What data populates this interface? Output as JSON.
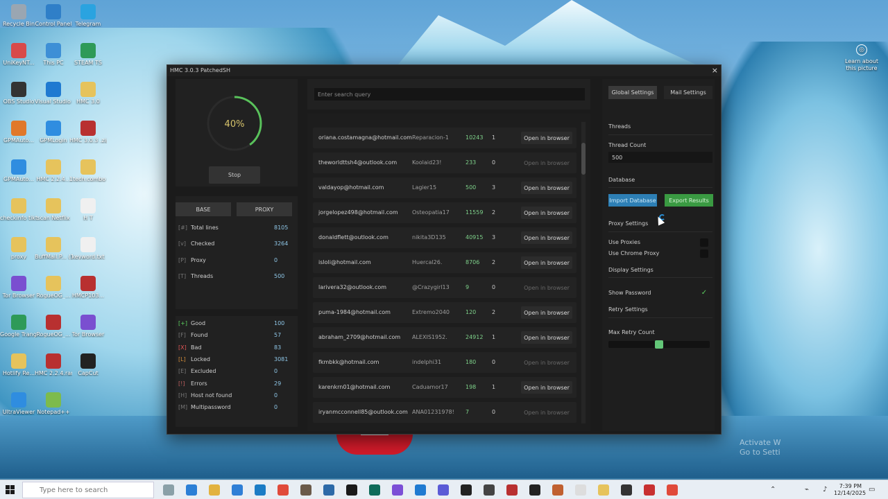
{
  "window": {
    "title": "HMC 3.0.3 PatchedSH",
    "close_label": "×"
  },
  "progress": {
    "percent_label": "40%",
    "percent_value": 40,
    "stop_label": "Stop"
  },
  "tabs": {
    "base_label": "BASE",
    "proxy_label": "PROXY"
  },
  "stats_top": [
    {
      "key": "[#]",
      "name": "Total lines",
      "value": "8105"
    },
    {
      "key": "[v]",
      "name": "Checked",
      "value": "3264"
    },
    {
      "key": "[P]",
      "name": "Proxy",
      "value": "0"
    },
    {
      "key": "[T]",
      "name": "Threads",
      "value": "500"
    }
  ],
  "stats_bottom": [
    {
      "key": "[+]",
      "name": "Good",
      "value": "100",
      "key_color": "#5bd15f"
    },
    {
      "key": "[F]",
      "name": "Found",
      "value": "57",
      "key_color": "#777777"
    },
    {
      "key": "[X]",
      "name": "Bad",
      "value": "83",
      "key_color": "#e05555"
    },
    {
      "key": "[L]",
      "name": "Locked",
      "value": "3081",
      "key_color": "#d08b3a"
    },
    {
      "key": "[E]",
      "name": "Excluded",
      "value": "0",
      "key_color": "#777777"
    },
    {
      "key": "[!]",
      "name": "Errors",
      "value": "29",
      "key_color": "#c06060"
    },
    {
      "key": "[H]",
      "name": "Host not found",
      "value": "0",
      "key_color": "#777777"
    },
    {
      "key": "[M]",
      "name": "Multipassword",
      "value": "0",
      "key_color": "#777777"
    }
  ],
  "search": {
    "placeholder": "Enter search query"
  },
  "results": [
    {
      "email": "oriana.costamagna@hotmail.com",
      "password": "Reparacion-1",
      "count": "10243",
      "mails": "1",
      "action": "Open in browser",
      "active": true
    },
    {
      "email": "theworldttsh4@outlook.com",
      "password": "Koolaid23!",
      "count": "233",
      "mails": "0",
      "action": "Open in browser",
      "active": false
    },
    {
      "email": "valdayop@hotmail.com",
      "password": "Lagier15",
      "count": "500",
      "mails": "3",
      "action": "Open in browser",
      "active": true
    },
    {
      "email": "jorgelopez498@hotmail.com",
      "password": "Osteopatia17",
      "count": "11559",
      "mails": "2",
      "action": "Open in browser",
      "active": true
    },
    {
      "email": "donaldflett@outlook.com",
      "password": "nikita3D135",
      "count": "40915",
      "mails": "3",
      "action": "Open in browser",
      "active": true
    },
    {
      "email": "isloli@hotmail.com",
      "password": "Huercal26.",
      "count": "8706",
      "mails": "2",
      "action": "Open in browser",
      "active": true
    },
    {
      "email": "larivera32@outlook.com",
      "password": "@Crazygirl13",
      "count": "9",
      "mails": "0",
      "action": "Open in browser",
      "active": false
    },
    {
      "email": "puma-1984@hotmail.com",
      "password": "Extremo2040",
      "count": "120",
      "mails": "2",
      "action": "Open in browser",
      "active": true
    },
    {
      "email": "abraham_2709@hotmail.com",
      "password": "ALEXIS1952.",
      "count": "24912",
      "mails": "1",
      "action": "Open in browser",
      "active": true
    },
    {
      "email": "fkmbkk@hotmail.com",
      "password": "indelphi31",
      "count": "180",
      "mails": "0",
      "action": "Open in browser",
      "active": false
    },
    {
      "email": "karenkrn01@hotmail.com",
      "password": "Caduamor17",
      "count": "198",
      "mails": "1",
      "action": "Open in browser",
      "active": true
    },
    {
      "email": "iryanmcconnell85@outlook.com",
      "password": "ANA01231978!",
      "count": "7",
      "mails": "0",
      "action": "Open in browser",
      "active": false
    }
  ],
  "settings": {
    "global_tab": "Global Settings",
    "mail_tab": "Mail Settings",
    "threads_header": "Threads",
    "thread_count_label": "Thread Count",
    "thread_count_value": "500",
    "database_header": "Database",
    "import_label": "Import Database",
    "export_label": "Export Results",
    "proxy_header": "Proxy Settings",
    "use_proxies_label": "Use Proxies",
    "use_chrome_proxy_label": "Use Chrome Proxy",
    "display_header": "Display Settings",
    "show_password_label": "Show Password",
    "retry_header": "Retry Settings",
    "max_retry_label": "Max Retry Count"
  },
  "desktop_icons": [
    {
      "label": "Recycle Bin",
      "color": "#9aa6b2"
    },
    {
      "label": "Control Panel",
      "color": "#2f7fc8"
    },
    {
      "label": "Telegram",
      "color": "#2aa3e0"
    },
    {
      "label": "UniKeyNT...",
      "color": "#d84a4a"
    },
    {
      "label": "This PC",
      "color": "#3d8fd6"
    },
    {
      "label": "STEAM TS",
      "color": "#2e9a58"
    },
    {
      "label": "OBS Studio",
      "color": "#333333"
    },
    {
      "label": "Visual Studio Code",
      "color": "#1f7ad1"
    },
    {
      "label": "HMC 3.0",
      "color": "#e6c35c"
    },
    {
      "label": "GPMAuto...",
      "color": "#e0782a"
    },
    {
      "label": "GPMLogin",
      "color": "#2f8de0"
    },
    {
      "label": "HMC 3.0.3 .zip",
      "color": "#b83030"
    },
    {
      "label": "GPMAuto...",
      "color": "#2f8de0"
    },
    {
      "label": "HMC 2.2.4...",
      "color": "#e6c35c"
    },
    {
      "label": "1tech.combo v3",
      "color": "#e6c35c"
    },
    {
      "label": "checkinfo tiktok",
      "color": "#e6c35c"
    },
    {
      "label": "scan Netflix",
      "color": "#e6c35c"
    },
    {
      "label": "H T",
      "color": "#f0f0f0"
    },
    {
      "label": "proxy",
      "color": "#e6c35c"
    },
    {
      "label": "BuffMail.P... (1)",
      "color": "#e6c35c"
    },
    {
      "label": "keyword.txt",
      "color": "#f0f0f0"
    },
    {
      "label": "Tor Browser",
      "color": "#7a4fd0"
    },
    {
      "label": "RogueOG_...",
      "color": "#e6c35c"
    },
    {
      "label": "HMCP103...",
      "color": "#b83030"
    },
    {
      "label": "Google Trang tính",
      "color": "#2e9a58"
    },
    {
      "label": "RogueOG_...",
      "color": "#b83030"
    },
    {
      "label": "Tor Browser",
      "color": "#7a4fd0"
    },
    {
      "label": "Hotlify Re...",
      "color": "#e6c35c"
    },
    {
      "label": "HMC 2.2.4.rar",
      "color": "#b83030"
    },
    {
      "label": "CapCut",
      "color": "#222222"
    },
    {
      "label": "UltraViewer",
      "color": "#2f8de0"
    },
    {
      "label": "Notepad++",
      "color": "#7dbb4c"
    }
  ],
  "learn": {
    "text": "Learn about this picture"
  },
  "activate": {
    "line1": "Activate W",
    "line2": "Go to Setti"
  },
  "taskbar": {
    "search_placeholder": "Type here to search",
    "time": "7:39 PM",
    "date": "12/14/2025"
  }
}
